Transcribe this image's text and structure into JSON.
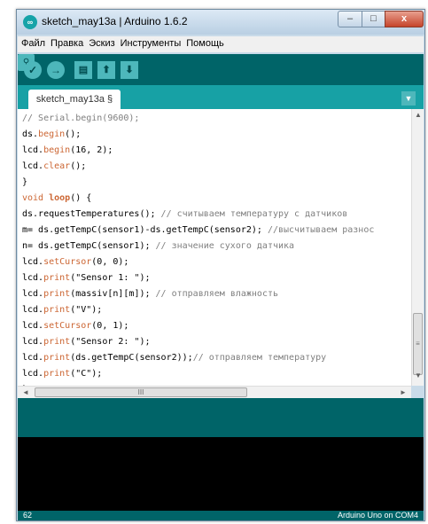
{
  "window": {
    "title": "sketch_may13a | Arduino 1.6.2",
    "app_icon": "arduino-logo-icon"
  },
  "title_buttons": {
    "minimize": "–",
    "maximize": "□",
    "close": "x"
  },
  "menu": [
    "Файл",
    "Правка",
    "Эскиз",
    "Инструменты",
    "Помощь"
  ],
  "toolbar": {
    "verify_icon": "✓",
    "upload_icon": "→",
    "new_icon": "▤",
    "open_icon": "⬆",
    "save_icon": "⬇",
    "serial_icon": "⚲"
  },
  "tab": {
    "label": "sketch_may13a §",
    "menu_icon": "▼"
  },
  "code": {
    "l1": "// Serial.begin(9600);",
    "l2a": "ds.",
    "l2b": "begin",
    "l2c": "();",
    "l3a": "lcd.",
    "l3b": "begin",
    "l3c": "(16, 2);",
    "l4a": "lcd.",
    "l4b": "clear",
    "l4c": "();",
    "l5": "}",
    "l6a": "void ",
    "l6b": "loop",
    "l6c": "() {",
    "l7a": "ds.requestTemperatures(); ",
    "l7b": "// считываем температуру с датчиков",
    "l8a": "m= ds.getTempC(sensor1)-ds.getTempC(sensor2); ",
    "l8b": "//высчитываем разнос",
    "l9a": "n= ds.getTempC(sensor1); ",
    "l9b": "// значение сухого датчика",
    "l10a": "lcd.",
    "l10b": "setCursor",
    "l10c": "(0, 0);",
    "l11a": "lcd.",
    "l11b": "print",
    "l11c": "(\"Sensor 1: \");",
    "l12a": "lcd.",
    "l12b": "print",
    "l12c": "(massiv[n][m]); ",
    "l12d": "// отправляем влажность",
    "l13a": "lcd.",
    "l13b": "print",
    "l13c": "(\"V\");",
    "l14a": "lcd.",
    "l14b": "setCursor",
    "l14c": "(0, 1);",
    "l15a": "lcd.",
    "l15b": "print",
    "l15c": "(\"Sensor 2: \");",
    "l16a": "lcd.",
    "l16b": "print",
    "l16c": "(ds.getTempC(sensor2));",
    "l16d": "// отправляем температуру",
    "l17a": "lcd.",
    "l17b": "print",
    "l17c": "(\"C\");",
    "l18": "}"
  },
  "scroll": {
    "up": "▲",
    "down": "▼",
    "left": "◄",
    "right": "►",
    "grip_v": "≡",
    "grip_h": "III"
  },
  "status": {
    "line": "62",
    "board": "Arduino Uno on COM4"
  },
  "colors": {
    "toolbar": "#006468",
    "tabbar": "#17a1a5",
    "keyword": "#cc6633",
    "comment": "#7f7f7f"
  }
}
